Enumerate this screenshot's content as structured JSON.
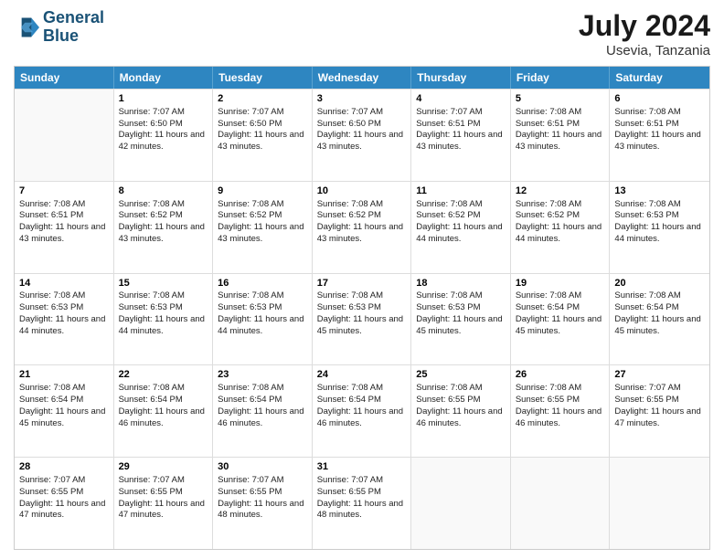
{
  "header": {
    "logo_line1": "General",
    "logo_line2": "Blue",
    "month_year": "July 2024",
    "location": "Usevia, Tanzania"
  },
  "days_of_week": [
    "Sunday",
    "Monday",
    "Tuesday",
    "Wednesday",
    "Thursday",
    "Friday",
    "Saturday"
  ],
  "weeks": [
    [
      {
        "day": "",
        "content": ""
      },
      {
        "day": "1",
        "content": "Sunrise: 7:07 AM\nSunset: 6:50 PM\nDaylight: 11 hours\nand 42 minutes."
      },
      {
        "day": "2",
        "content": "Sunrise: 7:07 AM\nSunset: 6:50 PM\nDaylight: 11 hours\nand 43 minutes."
      },
      {
        "day": "3",
        "content": "Sunrise: 7:07 AM\nSunset: 6:50 PM\nDaylight: 11 hours\nand 43 minutes."
      },
      {
        "day": "4",
        "content": "Sunrise: 7:07 AM\nSunset: 6:51 PM\nDaylight: 11 hours\nand 43 minutes."
      },
      {
        "day": "5",
        "content": "Sunrise: 7:08 AM\nSunset: 6:51 PM\nDaylight: 11 hours\nand 43 minutes."
      },
      {
        "day": "6",
        "content": "Sunrise: 7:08 AM\nSunset: 6:51 PM\nDaylight: 11 hours\nand 43 minutes."
      }
    ],
    [
      {
        "day": "7",
        "content": "Sunrise: 7:08 AM\nSunset: 6:51 PM\nDaylight: 11 hours\nand 43 minutes."
      },
      {
        "day": "8",
        "content": "Sunrise: 7:08 AM\nSunset: 6:52 PM\nDaylight: 11 hours\nand 43 minutes."
      },
      {
        "day": "9",
        "content": "Sunrise: 7:08 AM\nSunset: 6:52 PM\nDaylight: 11 hours\nand 43 minutes."
      },
      {
        "day": "10",
        "content": "Sunrise: 7:08 AM\nSunset: 6:52 PM\nDaylight: 11 hours\nand 43 minutes."
      },
      {
        "day": "11",
        "content": "Sunrise: 7:08 AM\nSunset: 6:52 PM\nDaylight: 11 hours\nand 44 minutes."
      },
      {
        "day": "12",
        "content": "Sunrise: 7:08 AM\nSunset: 6:52 PM\nDaylight: 11 hours\nand 44 minutes."
      },
      {
        "day": "13",
        "content": "Sunrise: 7:08 AM\nSunset: 6:53 PM\nDaylight: 11 hours\nand 44 minutes."
      }
    ],
    [
      {
        "day": "14",
        "content": "Sunrise: 7:08 AM\nSunset: 6:53 PM\nDaylight: 11 hours\nand 44 minutes."
      },
      {
        "day": "15",
        "content": "Sunrise: 7:08 AM\nSunset: 6:53 PM\nDaylight: 11 hours\nand 44 minutes."
      },
      {
        "day": "16",
        "content": "Sunrise: 7:08 AM\nSunset: 6:53 PM\nDaylight: 11 hours\nand 44 minutes."
      },
      {
        "day": "17",
        "content": "Sunrise: 7:08 AM\nSunset: 6:53 PM\nDaylight: 11 hours\nand 45 minutes."
      },
      {
        "day": "18",
        "content": "Sunrise: 7:08 AM\nSunset: 6:53 PM\nDaylight: 11 hours\nand 45 minutes."
      },
      {
        "day": "19",
        "content": "Sunrise: 7:08 AM\nSunset: 6:54 PM\nDaylight: 11 hours\nand 45 minutes."
      },
      {
        "day": "20",
        "content": "Sunrise: 7:08 AM\nSunset: 6:54 PM\nDaylight: 11 hours\nand 45 minutes."
      }
    ],
    [
      {
        "day": "21",
        "content": "Sunrise: 7:08 AM\nSunset: 6:54 PM\nDaylight: 11 hours\nand 45 minutes."
      },
      {
        "day": "22",
        "content": "Sunrise: 7:08 AM\nSunset: 6:54 PM\nDaylight: 11 hours\nand 46 minutes."
      },
      {
        "day": "23",
        "content": "Sunrise: 7:08 AM\nSunset: 6:54 PM\nDaylight: 11 hours\nand 46 minutes."
      },
      {
        "day": "24",
        "content": "Sunrise: 7:08 AM\nSunset: 6:54 PM\nDaylight: 11 hours\nand 46 minutes."
      },
      {
        "day": "25",
        "content": "Sunrise: 7:08 AM\nSunset: 6:55 PM\nDaylight: 11 hours\nand 46 minutes."
      },
      {
        "day": "26",
        "content": "Sunrise: 7:08 AM\nSunset: 6:55 PM\nDaylight: 11 hours\nand 46 minutes."
      },
      {
        "day": "27",
        "content": "Sunrise: 7:07 AM\nSunset: 6:55 PM\nDaylight: 11 hours\nand 47 minutes."
      }
    ],
    [
      {
        "day": "28",
        "content": "Sunrise: 7:07 AM\nSunset: 6:55 PM\nDaylight: 11 hours\nand 47 minutes."
      },
      {
        "day": "29",
        "content": "Sunrise: 7:07 AM\nSunset: 6:55 PM\nDaylight: 11 hours\nand 47 minutes."
      },
      {
        "day": "30",
        "content": "Sunrise: 7:07 AM\nSunset: 6:55 PM\nDaylight: 11 hours\nand 48 minutes."
      },
      {
        "day": "31",
        "content": "Sunrise: 7:07 AM\nSunset: 6:55 PM\nDaylight: 11 hours\nand 48 minutes."
      },
      {
        "day": "",
        "content": ""
      },
      {
        "day": "",
        "content": ""
      },
      {
        "day": "",
        "content": ""
      }
    ]
  ]
}
